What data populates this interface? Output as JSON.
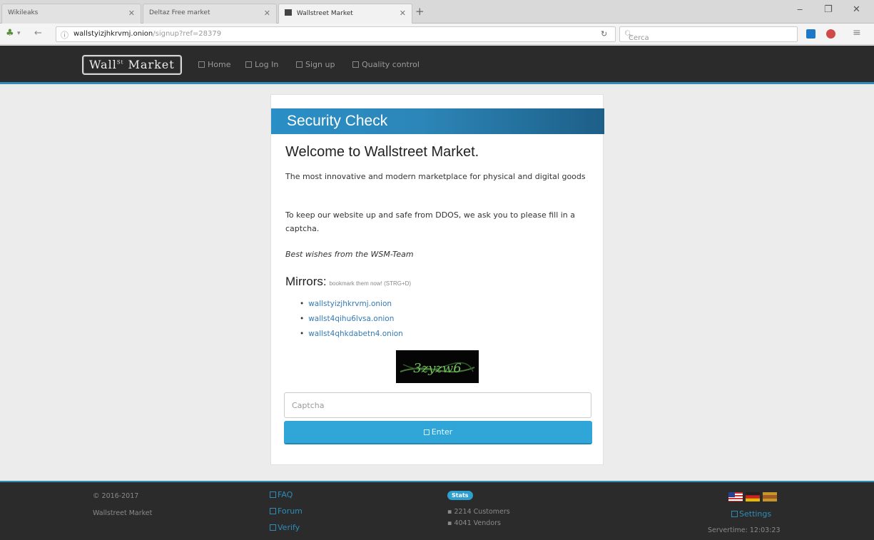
{
  "browser": {
    "tabs": [
      {
        "label": "Wikileaks"
      },
      {
        "label": "Deltaz Free market"
      },
      {
        "label": "Wallstreet Market"
      }
    ],
    "url": {
      "host": "wallstyizjhkrvmj.onion",
      "path": "/signup?ref=28379"
    },
    "search_placeholder": "Cerca"
  },
  "header": {
    "logo": "Wall",
    "logo_sup": "St",
    "logo_rest": " Market",
    "nav": [
      {
        "label": "Home"
      },
      {
        "label": "Log In"
      },
      {
        "label": "Sign up"
      },
      {
        "label": "Quality control"
      }
    ]
  },
  "main": {
    "panel_title": "Security Check",
    "welcome": "Welcome to Wallstreet Market.",
    "intro": "The most innovative and modern marketplace for physical and digital goods",
    "ddos_text": "To keep our website up and safe from DDOS, we ask you to please fill in a captcha.",
    "signoff": "Best wishes from the WSM-Team",
    "mirrors_title": "Mirrors:",
    "mirrors_note": "bookmark them now! (STRG+D)",
    "mirrors": [
      "wallstyizjhkrvmj.onion",
      "wallst4qihu6lvsa.onion",
      "wallst4qhkdabetn4.onion"
    ],
    "captcha_text": "3zyzw6",
    "captcha_placeholder": "Captcha",
    "enter_label": "Enter"
  },
  "footer": {
    "copyright": "© 2016-2017",
    "tagline": "Wallstreet Market",
    "links": [
      {
        "label": "FAQ"
      },
      {
        "label": "Forum"
      },
      {
        "label": "Verify"
      }
    ],
    "stats_badge": "Stats",
    "stats": [
      "2214 Customers",
      "4041 Vendors"
    ],
    "settings_label": "Settings",
    "servertime": "Servertime: 12:03:23"
  },
  "colors": {
    "accent": "#2f8cb9",
    "header_bg": "#2b2b2b",
    "button": "#30a6d8"
  }
}
